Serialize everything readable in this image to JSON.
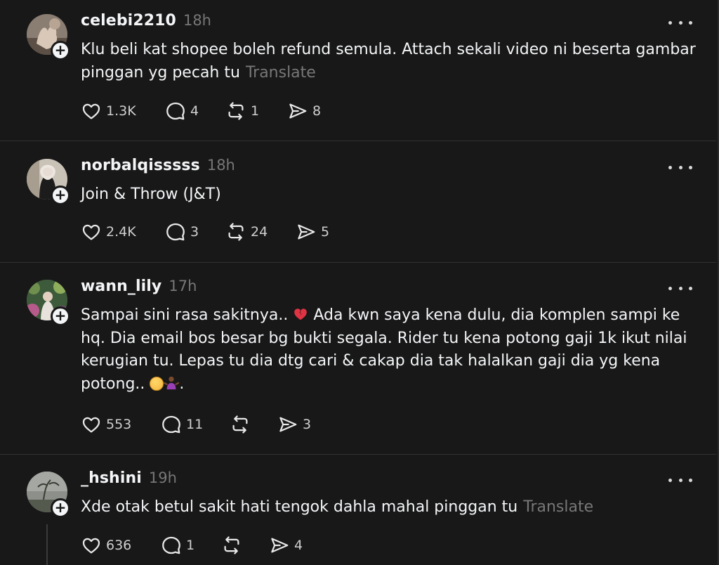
{
  "posts": [
    {
      "username": "celebi2210",
      "time": "18h",
      "text": "Klu beli kat shopee boleh refund semula. Attach sekali video ni beserta gambar pinggan yg pecah tu",
      "translate": "Translate",
      "likes": "1.3K",
      "replies": "4",
      "reposts": "1",
      "shares": "8"
    },
    {
      "username": "norbalqisssss",
      "time": "18h",
      "text": "Join & Throw (J&T)",
      "likes": "2.4K",
      "replies": "3",
      "reposts": "24",
      "shares": "5"
    },
    {
      "username": "wann_lily",
      "time": "17h",
      "text_before_heart": "Sampai sini rasa sakitnya.. ",
      "text_after_heart": " Ada kwn saya kena dulu, dia komplen sampi ke hq. Dia email bos besar bg bukti segala. Rider tu kena potong gaji 1k ikut nilai kerugian tu. Lepas tu dia dtg cari & cakap dia tak halalkan gaji dia yg kena potong.. ",
      "text_end": ".",
      "likes": "553",
      "replies": "11",
      "reposts": "",
      "shares": "3"
    },
    {
      "username": "_hshini",
      "time": "19h",
      "text": "Xde otak betul sakit hati tengok dahla mahal pinggan tu",
      "translate": "Translate",
      "likes": "636",
      "replies": "1",
      "reposts": "",
      "shares": "4"
    }
  ],
  "icons": {
    "like": "heart-icon",
    "reply": "comment-icon",
    "repost": "repost-icon",
    "share": "share-icon",
    "more": "more-options-icon",
    "follow": "follow-plus-icon"
  },
  "colors": {
    "background": "#181818",
    "text": "#f3f5f7",
    "muted": "#777777"
  }
}
